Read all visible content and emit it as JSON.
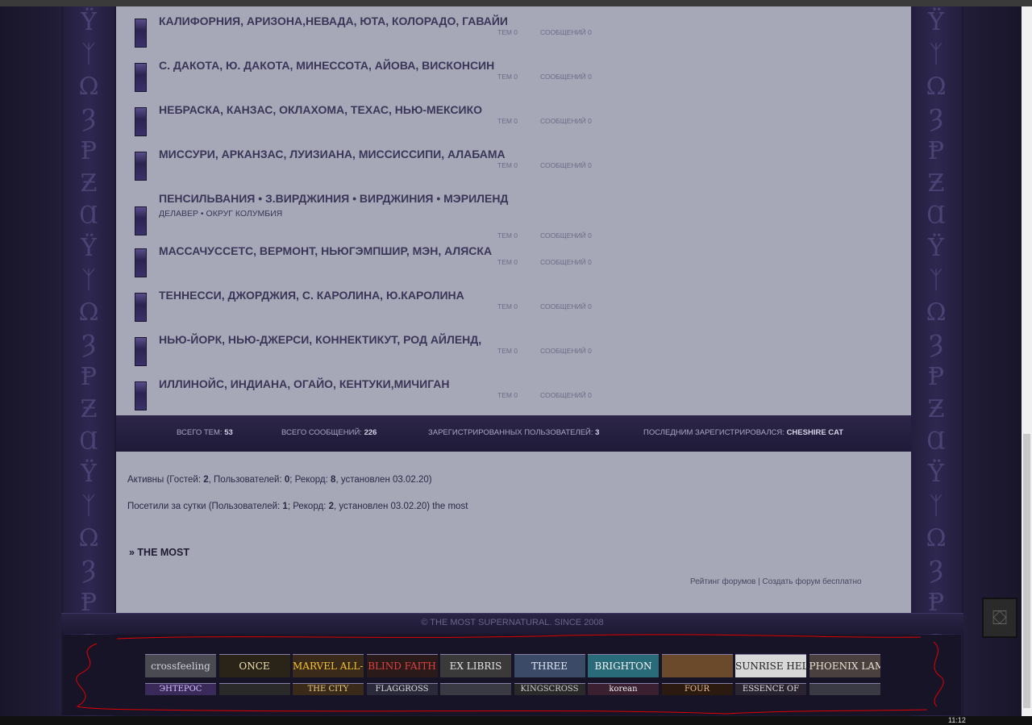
{
  "forums": [
    {
      "title": "КАЛИФОРНИЯ, АРИЗОНА,НЕВАДА, ЮТА, КОЛОРАДО, ГАВАЙИ",
      "subtitle": "",
      "topics": "ТЕМ 0",
      "posts": "СООБЩЕНИЙ 0"
    },
    {
      "title": "С. ДАКОТА, Ю. ДАКОТА, МИНЕССОТА, АЙОВА, ВИСКОНСИН",
      "subtitle": "",
      "topics": "ТЕМ 0",
      "posts": "СООБЩЕНИЙ 0"
    },
    {
      "title": "НЕБРАСКА, КАНЗАС, ОКЛАХОМА, ТЕХАС, НЬЮ-МЕКСИКО",
      "subtitle": "",
      "topics": "ТЕМ 0",
      "posts": "СООБЩЕНИЙ 0"
    },
    {
      "title": "МИССУРИ, АРКАНЗАС, ЛУИЗИАНА, МИССИССИПИ, АЛАБАМА",
      "subtitle": "",
      "topics": "ТЕМ 0",
      "posts": "СООБЩЕНИЙ 0"
    },
    {
      "title": "ПЕНСИЛЬВАНИЯ • З.ВИРДЖИНИЯ • ВИРДЖИНИЯ • МЭРИЛЕНД",
      "subtitle": "ДЕЛАВЕР • ОКРУГ КОЛУМБИЯ",
      "topics": "ТЕМ 0",
      "posts": "СООБЩЕНИЙ 0"
    },
    {
      "title": "МАССАЧУССЕТС, ВЕРМОНТ, НЬЮГЭМПШИР, МЭН, АЛЯСКА",
      "subtitle": "",
      "topics": "ТЕМ 0",
      "posts": "СООБЩЕНИЙ 0"
    },
    {
      "title": "ТЕННЕССИ, ДЖОРДЖИЯ, С. КАРОЛИНА, Ю.КАРОЛИНА",
      "subtitle": "",
      "topics": "ТЕМ 0",
      "posts": "СООБЩЕНИЙ 0"
    },
    {
      "title": "НЬЮ-ЙОРК, НЬЮ-ДЖЕРСИ, КОННЕКТИКУТ, РОД АЙЛЕНД,",
      "subtitle": "",
      "topics": "ТЕМ 0",
      "posts": "СООБЩЕНИЙ 0"
    },
    {
      "title": "ИЛЛИНОЙС, ИНДИАНА, ОГАЙО, КЕНТУКИ,МИЧИГАН",
      "subtitle": "",
      "topics": "ТЕМ 0",
      "posts": "СООБЩЕНИЙ 0"
    }
  ],
  "stats": {
    "total_topics_label": "ВСЕГО ТЕМ:",
    "total_topics": "53",
    "total_posts_label": "ВСЕГО СООБЩЕНИЙ:",
    "total_posts": "226",
    "registered_label": "ЗАРЕГИСТРИРОВАННЫХ ПОЛЬЗОВАТЕЛЕЙ:",
    "registered": "3",
    "last_registered_label": "ПОСЛЕДНИМ ЗАРЕГИСТРИРОВАЛСЯ:",
    "last_registered": "CHESHIRE CAT"
  },
  "online": {
    "active_prefix": "Активны (Гостей: ",
    "guests": "2",
    "active_users_label": ", Пользователей: ",
    "users": "0",
    "active_record_label": "; Рекорд: ",
    "record": "8",
    "active_suffix": ", установлен 03.02.20)",
    "today_prefix": "Посетили за сутки (Пользователей: ",
    "today_users": "1",
    "today_record_label": "; Рекорд: ",
    "today_record": "2",
    "today_suffix": ", установлен 03.02.20) the most"
  },
  "forum_link": "» THE MOST",
  "footer_links": {
    "rating": "Рейтинг форумов",
    "separator": "|",
    "create": "Создать форум бесплатно"
  },
  "copyright": "© THE MOST SUPERNATURAL. SINCE 2008",
  "banners": [
    {
      "label": "crossfeeling",
      "color": "#cfd2d8",
      "bg": "#4a4a52"
    },
    {
      "label": "ONCE",
      "color": "#f0e0b0",
      "bg": "#2a2418"
    },
    {
      "label": "MARVEL ALL-NEW",
      "color": "#f2c12e",
      "bg": "#3a2a1a"
    },
    {
      "label": "BLIND FAITH",
      "color": "#e04040",
      "bg": "#2a1a1a"
    },
    {
      "label": "EX LIBRIS",
      "color": "#e6e6e6",
      "bg": "#3a3a3a"
    },
    {
      "label": "THREE",
      "color": "#dfe8f4",
      "bg": "#3b4a66"
    },
    {
      "label": "BRIGHTON",
      "color": "#f4f4f4",
      "bg": "#2a6b7a"
    },
    {
      "label": "",
      "color": "#e0c090",
      "bg": "#6a4a2a"
    },
    {
      "label": "SUNRISE HELHEIM",
      "color": "#222222",
      "bg": "#d8d8d8"
    },
    {
      "label": "PHOENIX LAMENT",
      "color": "#e8e0d0",
      "bg": "#4a4040"
    }
  ],
  "banners_row2": [
    {
      "label": "ЭНТЕРОС",
      "color": "#d8c0ff",
      "bg": "#3a2a5a"
    },
    {
      "label": "",
      "color": "#cccccc",
      "bg": "#2a2a2a"
    },
    {
      "label": "THE CITY",
      "color": "#f0d080",
      "bg": "#3a2a1a"
    },
    {
      "label": "FLAGGROSS",
      "color": "#dddddd",
      "bg": "#2a2a3a"
    },
    {
      "label": "",
      "color": "#dddddd",
      "bg": "#3a3a44"
    },
    {
      "label": "KINGSCROSS",
      "color": "#cccccc",
      "bg": "#2a2a2a"
    },
    {
      "label": "korean",
      "color": "#f0f0f0",
      "bg": "#3a2030"
    },
    {
      "label": "FOUR",
      "color": "#f0c090",
      "bg": "#2a1a10"
    },
    {
      "label": "ESSENCE OF",
      "color": "#e0e0e0",
      "bg": "#2a2430"
    },
    {
      "label": "",
      "color": "#dddddd",
      "bg": "#3a3a44"
    }
  ],
  "clock": "11:12",
  "runes": [
    "Ϋ",
    "ᛉ",
    "Ω",
    "Ȝ",
    "Ᵽ",
    "Ƶ",
    "Ɑ",
    "Ϋ",
    "ᛉ",
    "Ω",
    "Ȝ",
    "Ᵽ",
    "Ƶ",
    "Ɑ",
    "Ϋ",
    "ᛉ",
    "Ω",
    "Ȝ",
    "Ᵽ",
    "Ƶ",
    "Ɑ",
    "Ϋ"
  ],
  "theme": {
    "panel": "#a6a8b8",
    "frame": "#1c1830",
    "title_text": "#3b3658"
  }
}
